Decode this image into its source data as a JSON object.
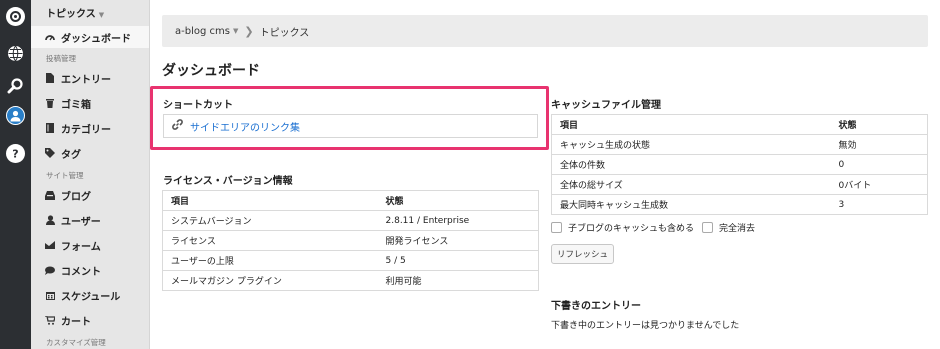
{
  "sidebar": {
    "blog_selector": "トピックス",
    "dashboard": "ダッシュボード",
    "group_posts": "投稿管理",
    "entries": "エントリー",
    "trash": "ゴミ箱",
    "categories": "カテゴリー",
    "tags": "タグ",
    "group_site": "サイト管理",
    "blogs": "ブログ",
    "users": "ユーザー",
    "forms": "フォーム",
    "comments": "コメント",
    "schedule": "スケジュール",
    "cart": "カート",
    "group_customize": "カスタマイズ管理"
  },
  "breadcrumb": {
    "root": "a-blog cms",
    "current": "トピックス"
  },
  "page_title": "ダッシュボード",
  "shortcut": {
    "title": "ショートカット",
    "link": "サイドエリアのリンク集"
  },
  "license": {
    "title": "ライセンス・バージョン情報",
    "headers": [
      "項目",
      "状態"
    ],
    "rows": [
      [
        "システムバージョン",
        "2.8.11 / Enterprise"
      ],
      [
        "ライセンス",
        "開発ライセンス"
      ],
      [
        "ユーザーの上限",
        "5 / 5"
      ],
      [
        "メールマガジン プラグイン",
        "利用可能"
      ]
    ]
  },
  "cache": {
    "title": "キャッシュファイル管理",
    "headers": [
      "項目",
      "状態"
    ],
    "rows": [
      [
        "キャッシュ生成の状態",
        "無効"
      ],
      [
        "全体の件数",
        "0"
      ],
      [
        "全体の総サイズ",
        "0バイト"
      ],
      [
        "最大同時キャッシュ生成数",
        "3"
      ]
    ],
    "include_child": "子ブログのキャッシュも含める",
    "full_delete": "完全消去",
    "refresh": "リフレッシュ"
  },
  "drafts": {
    "title": "下書きのエントリー",
    "empty": "下書き中のエントリーは見つかりませんでした"
  },
  "colors": {
    "highlight": "#e8336f",
    "link": "#1a6fd1",
    "rail": "#2c2f33"
  }
}
